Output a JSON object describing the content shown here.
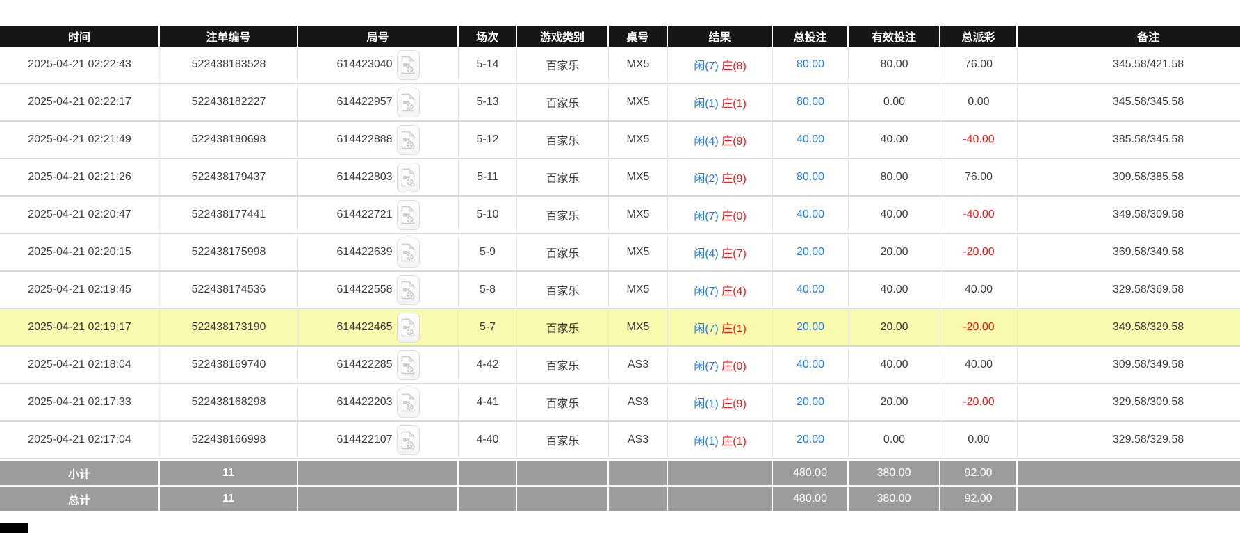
{
  "colors": {
    "header-bg": "#161616",
    "accent-blue": "#2277ee",
    "accent-red": "#f31212",
    "highlight-yellow": "#fafaae",
    "footer-gray": "#9c9c9c"
  },
  "icons": {
    "round_video_icon": "video-file-icon"
  },
  "table": {
    "columns": [
      {
        "key": "time",
        "label": "时间"
      },
      {
        "key": "bet_id",
        "label": "注单编号"
      },
      {
        "key": "round_id",
        "label": "局号"
      },
      {
        "key": "session",
        "label": "场次"
      },
      {
        "key": "game_type",
        "label": "游戏类别"
      },
      {
        "key": "table_no",
        "label": "桌号"
      },
      {
        "key": "result",
        "label": "结果"
      },
      {
        "key": "total_bet",
        "label": "总投注"
      },
      {
        "key": "valid_bet",
        "label": "有效投注"
      },
      {
        "key": "total_payout",
        "label": "总派彩"
      },
      {
        "key": "remark",
        "label": "备注"
      }
    ],
    "rows": [
      {
        "time": "2025-04-21 02:22:43",
        "bet_id": "522438183528",
        "round_id": "614423040",
        "session": "5-14",
        "game_type": "百家乐",
        "table_no": "MX5",
        "result_player": "闲(7)",
        "result_banker": "庄(8)",
        "total_bet": "80.00",
        "valid_bet": "80.00",
        "total_payout": "76.00",
        "remark": "345.58/421.58",
        "highlighted": false
      },
      {
        "time": "2025-04-21 02:22:17",
        "bet_id": "522438182227",
        "round_id": "614422957",
        "session": "5-13",
        "game_type": "百家乐",
        "table_no": "MX5",
        "result_player": "闲(1)",
        "result_banker": "庄(1)",
        "total_bet": "80.00",
        "valid_bet": "0.00",
        "total_payout": "0.00",
        "remark": "345.58/345.58",
        "highlighted": false
      },
      {
        "time": "2025-04-21 02:21:49",
        "bet_id": "522438180698",
        "round_id": "614422888",
        "session": "5-12",
        "game_type": "百家乐",
        "table_no": "MX5",
        "result_player": "闲(4)",
        "result_banker": "庄(9)",
        "total_bet": "40.00",
        "valid_bet": "40.00",
        "total_payout": "-40.00",
        "remark": "385.58/345.58",
        "highlighted": false
      },
      {
        "time": "2025-04-21 02:21:26",
        "bet_id": "522438179437",
        "round_id": "614422803",
        "session": "5-11",
        "game_type": "百家乐",
        "table_no": "MX5",
        "result_player": "闲(2)",
        "result_banker": "庄(9)",
        "total_bet": "80.00",
        "valid_bet": "80.00",
        "total_payout": "76.00",
        "remark": "309.58/385.58",
        "highlighted": false
      },
      {
        "time": "2025-04-21 02:20:47",
        "bet_id": "522438177441",
        "round_id": "614422721",
        "session": "5-10",
        "game_type": "百家乐",
        "table_no": "MX5",
        "result_player": "闲(7)",
        "result_banker": "庄(0)",
        "total_bet": "40.00",
        "valid_bet": "40.00",
        "total_payout": "-40.00",
        "remark": "349.58/309.58",
        "highlighted": false
      },
      {
        "time": "2025-04-21 02:20:15",
        "bet_id": "522438175998",
        "round_id": "614422639",
        "session": "5-9",
        "game_type": "百家乐",
        "table_no": "MX5",
        "result_player": "闲(4)",
        "result_banker": "庄(7)",
        "total_bet": "20.00",
        "valid_bet": "20.00",
        "total_payout": "-20.00",
        "remark": "369.58/349.58",
        "highlighted": false
      },
      {
        "time": "2025-04-21 02:19:45",
        "bet_id": "522438174536",
        "round_id": "614422558",
        "session": "5-8",
        "game_type": "百家乐",
        "table_no": "MX5",
        "result_player": "闲(7)",
        "result_banker": "庄(4)",
        "total_bet": "40.00",
        "valid_bet": "40.00",
        "total_payout": "40.00",
        "remark": "329.58/369.58",
        "highlighted": false
      },
      {
        "time": "2025-04-21 02:19:17",
        "bet_id": "522438173190",
        "round_id": "614422465",
        "session": "5-7",
        "game_type": "百家乐",
        "table_no": "MX5",
        "result_player": "闲(7)",
        "result_banker": "庄(1)",
        "total_bet": "20.00",
        "valid_bet": "20.00",
        "total_payout": "-20.00",
        "remark": "349.58/329.58",
        "highlighted": true
      },
      {
        "time": "2025-04-21 02:18:04",
        "bet_id": "522438169740",
        "round_id": "614422285",
        "session": "4-42",
        "game_type": "百家乐",
        "table_no": "AS3",
        "result_player": "闲(7)",
        "result_banker": "庄(0)",
        "total_bet": "40.00",
        "valid_bet": "40.00",
        "total_payout": "40.00",
        "remark": "309.58/349.58",
        "highlighted": false
      },
      {
        "time": "2025-04-21 02:17:33",
        "bet_id": "522438168298",
        "round_id": "614422203",
        "session": "4-41",
        "game_type": "百家乐",
        "table_no": "AS3",
        "result_player": "闲(1)",
        "result_banker": "庄(9)",
        "total_bet": "20.00",
        "valid_bet": "20.00",
        "total_payout": "-20.00",
        "remark": "329.58/309.58",
        "highlighted": false
      },
      {
        "time": "2025-04-21 02:17:04",
        "bet_id": "522438166998",
        "round_id": "614422107",
        "session": "4-40",
        "game_type": "百家乐",
        "table_no": "AS3",
        "result_player": "闲(1)",
        "result_banker": "庄(1)",
        "total_bet": "20.00",
        "valid_bet": "0.00",
        "total_payout": "0.00",
        "remark": "329.58/329.58",
        "highlighted": false
      }
    ],
    "footer": [
      {
        "label": "小计",
        "count": "11",
        "total_bet": "480.00",
        "valid_bet": "380.00",
        "total_payout": "92.00"
      },
      {
        "label": "总计",
        "count": "11",
        "total_bet": "480.00",
        "valid_bet": "380.00",
        "total_payout": "92.00"
      }
    ]
  }
}
